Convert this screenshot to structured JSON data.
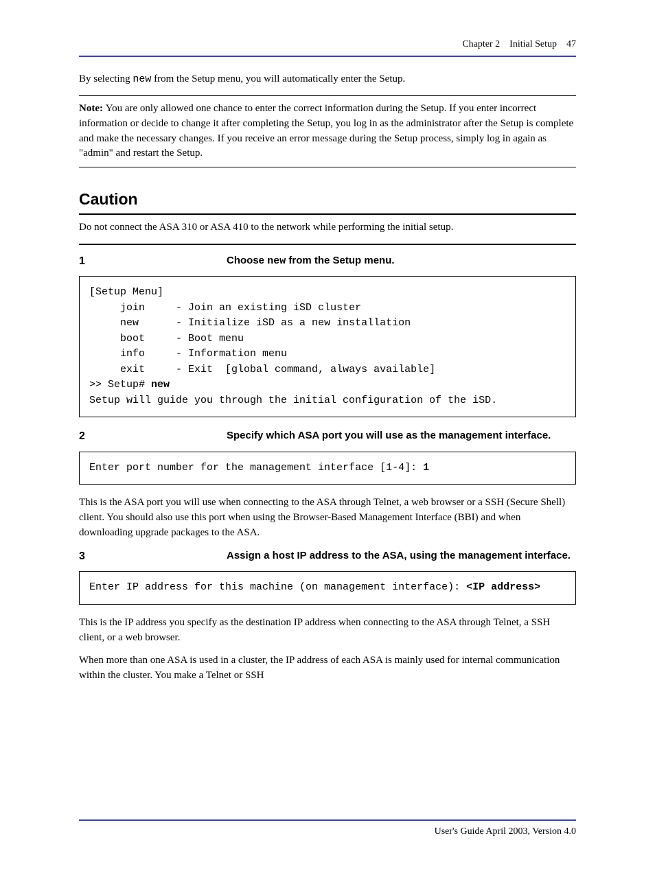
{
  "header": {
    "chapter": "Chapter 2",
    "title": "Initial Setup",
    "page": "47"
  },
  "footer": {
    "doc": "User's Guide April 2003, Version 4.0"
  },
  "p1_a": "By selecting ",
  "p1_b": "new",
  "p1_c": " from the Setup menu, you will automatically enter the Setup.",
  "note": {
    "label": "Note: ",
    "text": "You are only allowed one chance to enter the correct information during the Setup. If you enter incorrect information or decide to change it after completing the Setup, you log in as the administrator after the Setup is complete and make the necessary changes. If you receive an error message during the Setup process, simply log in again as \"admin\" and restart the Setup."
  },
  "caution": {
    "label": "Caution",
    "text": "Do not connect the ASA 310 or ASA 410 to the network while performing the initial setup."
  },
  "step1": {
    "num": "1",
    "pre": "Choose ",
    "cmd": "new",
    "post": " from the Setup menu."
  },
  "code1": "[Setup Menu]\n     join     - Join an existing iSD cluster\n     new      - Initialize iSD as a new installation\n     boot     - Boot menu\n     info     - Information menu\n     exit     - Exit  [global command, always available]\n>> Setup# ",
  "code1_bold": "new",
  "code1_b": "\nSetup will guide you through the initial configuration of the iSD.",
  "step2": {
    "num": "2",
    "text": "Specify which ASA port you will use as the management interface."
  },
  "code2_a": "Enter port number for the management interface [1-4]: ",
  "code2_bold": "1",
  "p2": "This is the ASA port you will use when connecting to the ASA through Telnet, a web browser or a SSH (Secure Shell) client. You should also use this port when using the Browser-Based Management Interface (BBI) and when downloading upgrade packages to the ASA.",
  "step3": {
    "num": "3",
    "text": "Assign a host IP address to the ASA, using the management interface."
  },
  "code3_a": "Enter IP address for this machine (on management interface): ",
  "code3_bold": "<IP address>",
  "p3": "This is the IP address you specify as the destination IP address when connecting to the ASA through Telnet, a SSH client, or a web browser.",
  "p4": "When more than one ASA is used in a cluster, the IP address of each ASA is mainly used for internal communication within the cluster. You make a Telnet or SSH"
}
